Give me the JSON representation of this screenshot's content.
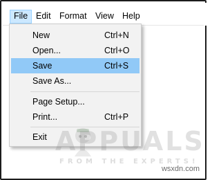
{
  "menubar": {
    "items": [
      {
        "label": "File",
        "active": true
      },
      {
        "label": "Edit"
      },
      {
        "label": "Format"
      },
      {
        "label": "View"
      },
      {
        "label": "Help"
      }
    ]
  },
  "file_menu": {
    "items": [
      {
        "label": "New",
        "shortcut": "Ctrl+N"
      },
      {
        "label": "Open...",
        "shortcut": "Ctrl+O"
      },
      {
        "label": "Save",
        "shortcut": "Ctrl+S",
        "highlighted": true
      },
      {
        "label": "Save As...",
        "shortcut": ""
      },
      {
        "label": "Page Setup...",
        "shortcut": ""
      },
      {
        "label": "Print...",
        "shortcut": "Ctrl+P"
      },
      {
        "label": "Exit",
        "shortcut": ""
      }
    ]
  },
  "watermark": {
    "brand": "APPUALS",
    "tagline": "FROM THE EXPERTS!",
    "site": "wsxdn.com"
  },
  "colors": {
    "highlight": "#91c9f7",
    "menu_bg": "#f2f2f2",
    "active_menubar": "#cce8ff"
  }
}
